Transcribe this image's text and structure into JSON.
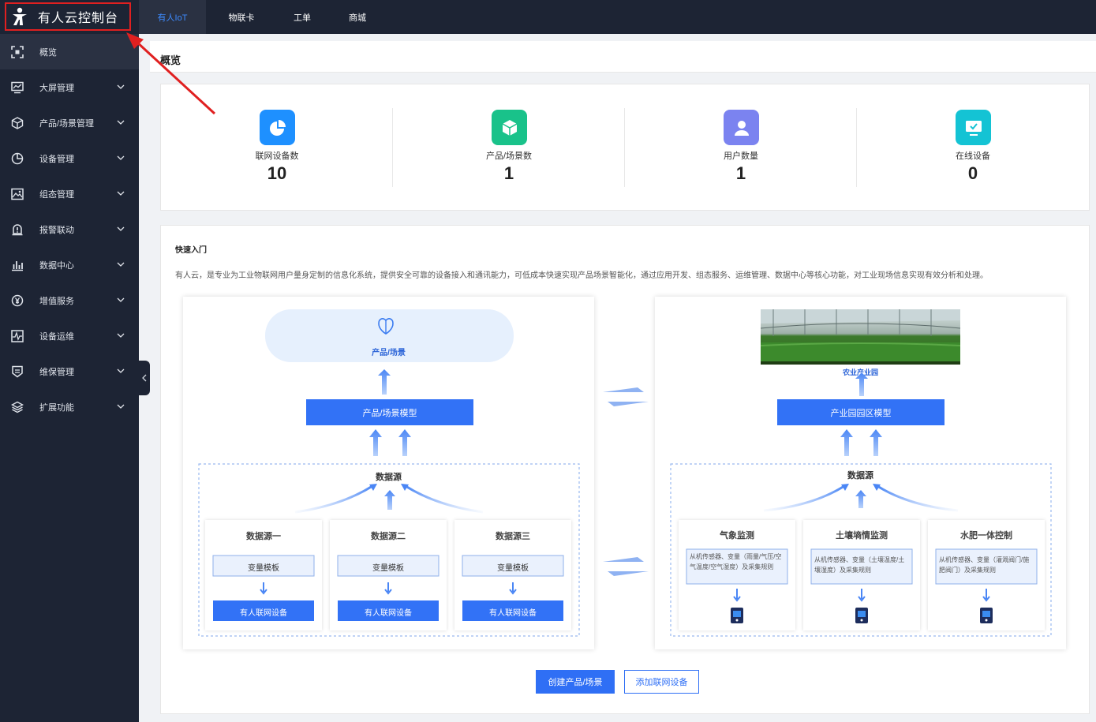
{
  "app": {
    "title": "有人云控制台"
  },
  "top_tabs": [
    {
      "label": "有人IoT",
      "active": true
    },
    {
      "label": "物联卡"
    },
    {
      "label": "工单"
    },
    {
      "label": "商城"
    }
  ],
  "sidebar": {
    "items": [
      {
        "label": "概览",
        "icon": "overview-icon",
        "active": true
      },
      {
        "label": "大屏管理",
        "icon": "monitor-icon"
      },
      {
        "label": "产品/场景管理",
        "icon": "cube-icon"
      },
      {
        "label": "设备管理",
        "icon": "pie-icon"
      },
      {
        "label": "组态管理",
        "icon": "image-icon"
      },
      {
        "label": "报警联动",
        "icon": "alarm-icon"
      },
      {
        "label": "数据中心",
        "icon": "bar-chart-icon"
      },
      {
        "label": "增值服务",
        "icon": "yen-icon"
      },
      {
        "label": "设备运维",
        "icon": "pulse-icon"
      },
      {
        "label": "维保管理",
        "icon": "shield-icon"
      },
      {
        "label": "扩展功能",
        "icon": "layers-icon"
      }
    ]
  },
  "breadcrumb": {
    "title": "概览"
  },
  "stats": [
    {
      "label": "联网设备数",
      "value": "10",
      "icon": "pie-chart-icon",
      "color": "#1e90ff"
    },
    {
      "label": "产品/场景数",
      "value": "1",
      "icon": "cube-icon",
      "color": "#19c28a"
    },
    {
      "label": "用户数量",
      "value": "1",
      "icon": "user-icon",
      "color": "#7b83f0"
    },
    {
      "label": "在线设备",
      "value": "0",
      "icon": "monitor-check-icon",
      "color": "#14c3d4"
    }
  ],
  "quick": {
    "title": "快速入门",
    "desc": "有人云，是专业为工业物联网用户量身定制的信息化系统，提供安全可靠的设备接入和通讯能力，可低成本快速实现产品场景智能化，通过应用开发、组态服务、运维管理、数据中心等核心功能，对工业现场信息实现有效分析和处理。",
    "left": {
      "top_label": "产品/场景",
      "model_label": "产品/场景模型",
      "source_title": "数据源",
      "sources": [
        {
          "title": "数据源一",
          "template": "变量模板",
          "device": "有人联网设备"
        },
        {
          "title": "数据源二",
          "template": "变量模板",
          "device": "有人联网设备"
        },
        {
          "title": "数据源三",
          "template": "变量模板",
          "device": "有人联网设备"
        }
      ]
    },
    "right": {
      "top_label": "农业产业园",
      "model_label": "产业园园区模型",
      "source_title": "数据源",
      "sources": [
        {
          "title": "气象监测",
          "desc": "从机传感器、变量（雨量/气压/空气温度/空气湿度）及采集规则"
        },
        {
          "title": "土壤墒情监测",
          "desc": "从机传感器、变量（土壤温度/土壤湿度）及采集规则"
        },
        {
          "title": "水肥一体控制",
          "desc": "从机传感器、变量（灌溉阀门/施肥阀门）及采集规则"
        }
      ]
    },
    "buttons": {
      "create": "创建产品/场景",
      "add": "添加联网设备"
    }
  },
  "colors": {
    "accent": "#2f6ff5",
    "sidebar_bg": "#1d2434",
    "highlight": "#e02020"
  }
}
